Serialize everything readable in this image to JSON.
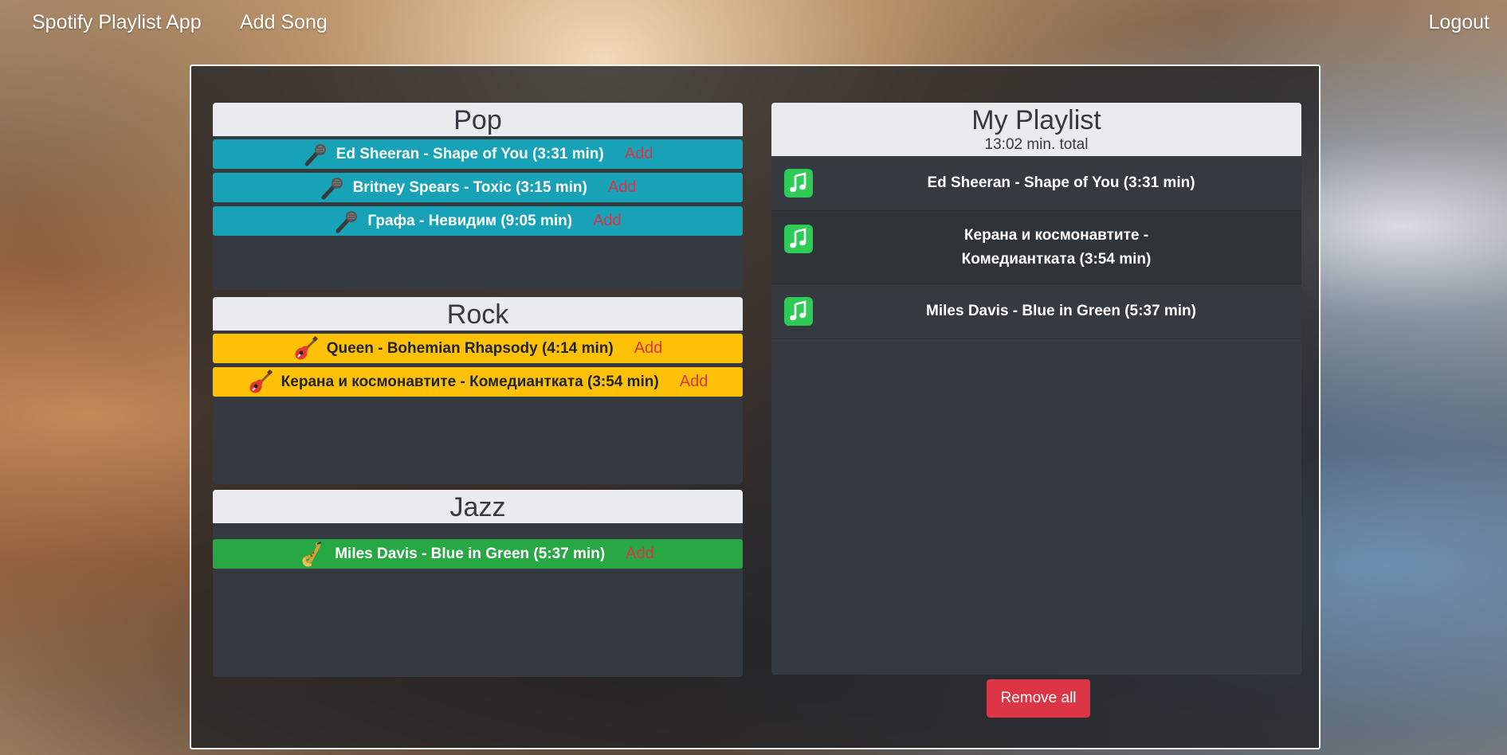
{
  "navbar": {
    "brand": "Spotify Playlist App",
    "add_song": "Add Song",
    "logout": "Logout"
  },
  "genres": {
    "pop": {
      "title": "Pop",
      "icon": "microphone-icon",
      "color": "#17a2b8",
      "songs": [
        {
          "label": "Ed Sheeran - Shape of You (3:31 min)",
          "add": "Add"
        },
        {
          "label": "Britney Spears - Toxic (3:15 min)",
          "add": "Add"
        },
        {
          "label": "Графа - Невидим (9:05 min)",
          "add": "Add"
        }
      ]
    },
    "rock": {
      "title": "Rock",
      "icon": "guitar-icon",
      "color": "#ffc107",
      "songs": [
        {
          "label": "Queen - Bohemian Rhapsody (4:14 min)",
          "add": "Add"
        },
        {
          "label": "Керана и космонавтите - Комедиантката (3:54 min)",
          "add": "Add"
        }
      ]
    },
    "jazz": {
      "title": "Jazz",
      "icon": "saxophone-icon",
      "color": "#28a745",
      "songs": [
        {
          "label": "Miles Davis - Blue in Green (5:37 min)",
          "add": "Add"
        }
      ]
    }
  },
  "playlist": {
    "title": "My Playlist",
    "total": "13:02 min. total",
    "icon": "music-note-icon",
    "items": [
      {
        "label": "Ed Sheeran - Shape of You (3:31 min)"
      },
      {
        "label": "Керана и космонавтите - Комедиантката (3:54 min)"
      },
      {
        "label": "Miles Davis - Blue in Green (5:37 min)"
      }
    ],
    "remove_all": "Remove all"
  },
  "colors": {
    "add_link": "#dc3545",
    "remove_button": "#dc3545",
    "card_background": "#343a40",
    "header_background": "#e9ecef"
  }
}
